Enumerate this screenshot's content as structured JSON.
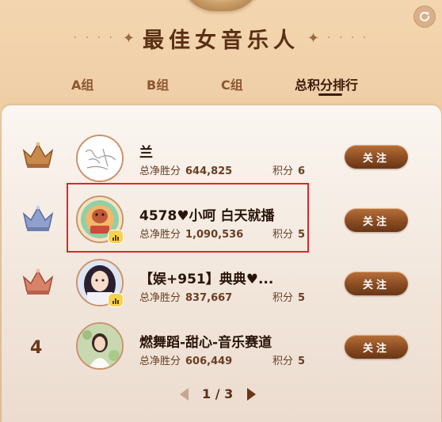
{
  "header": {
    "title": "最佳女音乐人"
  },
  "tabs": [
    {
      "label": "A组",
      "active": false
    },
    {
      "label": "B组",
      "active": false
    },
    {
      "label": "C组",
      "active": false
    },
    {
      "label": "总积分排行",
      "active": true
    }
  ],
  "labels": {
    "net_label": "总净胜分",
    "score_label": "积分",
    "follow": "关注"
  },
  "rows": [
    {
      "rank": "1",
      "rank_icon": "gold-crown-icon",
      "name": "兰",
      "net": "644,825",
      "score": "6",
      "live": false
    },
    {
      "rank": "2",
      "rank_icon": "silver-crown-icon",
      "name": "4578♥小呵 白天就播",
      "net": "1,090,536",
      "score": "5",
      "live": true
    },
    {
      "rank": "3",
      "rank_icon": "bronze-crown-icon",
      "name": "【娱+951】典典♥...",
      "net": "837,667",
      "score": "5",
      "live": true
    },
    {
      "rank": "4",
      "rank_icon": "",
      "name": "燃舞蹈-甜心-音乐赛道",
      "net": "606,449",
      "score": "5",
      "live": false
    }
  ],
  "pager": {
    "text": "1 / 3"
  },
  "colors": {
    "accent": "#6a3616",
    "highlight": "#e0262a",
    "gold": "#c88a4a",
    "silver": "#8fa0cf",
    "bronze": "#d9826a"
  }
}
